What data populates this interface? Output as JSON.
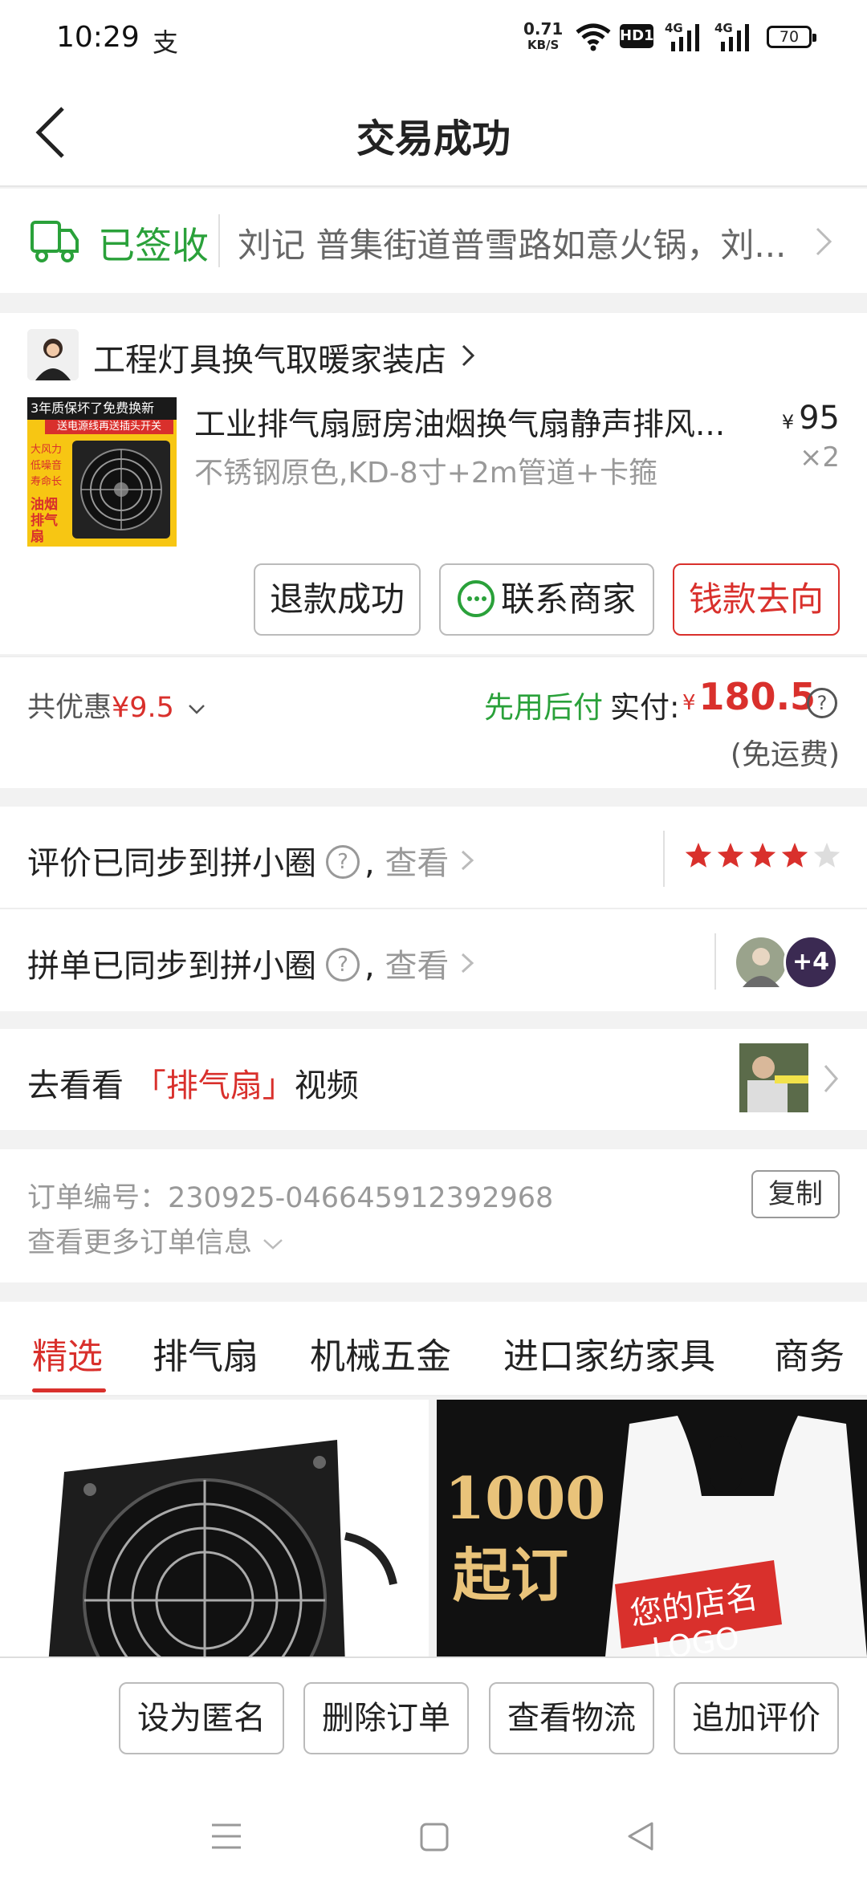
{
  "status_bar": {
    "time": "10:29",
    "app_icon": "支",
    "net_speed_value": "0.71",
    "net_speed_unit": "KB/S",
    "hd_label": "HD1",
    "sig_label_1": "4G",
    "sig_label_2": "4G",
    "battery": "70"
  },
  "header": {
    "title": "交易成功"
  },
  "delivery": {
    "status": "已签收",
    "address": "刘记 普集街道普雪路如意火锅，刘..."
  },
  "store": {
    "name": "工程灯具换气取暖家装店",
    "product": {
      "title": "工业排气扇厨房油烟换气扇静声排风...",
      "spec": "不锈钢原色,KD-8寸+2m管道+卡箍",
      "currency": "¥",
      "price": "95",
      "qty": "×2",
      "image_banner": "3年质保坏了免费换新",
      "image_sub": "送电源线再送插头开关",
      "image_features": [
        "大风力",
        "低噪音",
        "寿命长"
      ],
      "image_label": "油烟排气扇"
    },
    "buttons": {
      "refund": "退款成功",
      "contact": "联系商家",
      "money": "钱款去向"
    }
  },
  "summary": {
    "discount_label": "共优惠",
    "discount_value": "¥9.5",
    "pay_later": "先用后付",
    "paid_label": "实付:",
    "currency": "¥",
    "paid_amount": "180.5",
    "shipping": "(免运费)"
  },
  "sync": {
    "review_label": "评价已同步到拼小圈",
    "group_label": "拼单已同步到拼小圈",
    "view": "查看",
    "help": "?",
    "comma": ",",
    "rating": 4,
    "rating_max": 5,
    "extra_count": "+4"
  },
  "video": {
    "prefix": "去看看",
    "keyword": "「排气扇」",
    "suffix": "视频"
  },
  "order": {
    "number_label": "订单编号：",
    "number": "230925-046645912392968",
    "copy": "复制",
    "more": "查看更多订单信息"
  },
  "tabs": [
    "精选",
    "排气扇",
    "机械五金",
    "进口家纺家具",
    "商务"
  ],
  "feed": {
    "ad_big": "1000",
    "ad_sub": "起订",
    "ad_bag": "您的店名",
    "ad_logo": "LOGO"
  },
  "actions": [
    "设为匿名",
    "删除订单",
    "查看物流",
    "追加评价"
  ],
  "colors": {
    "accent_red": "#d9302c",
    "green": "#2aa13a"
  }
}
